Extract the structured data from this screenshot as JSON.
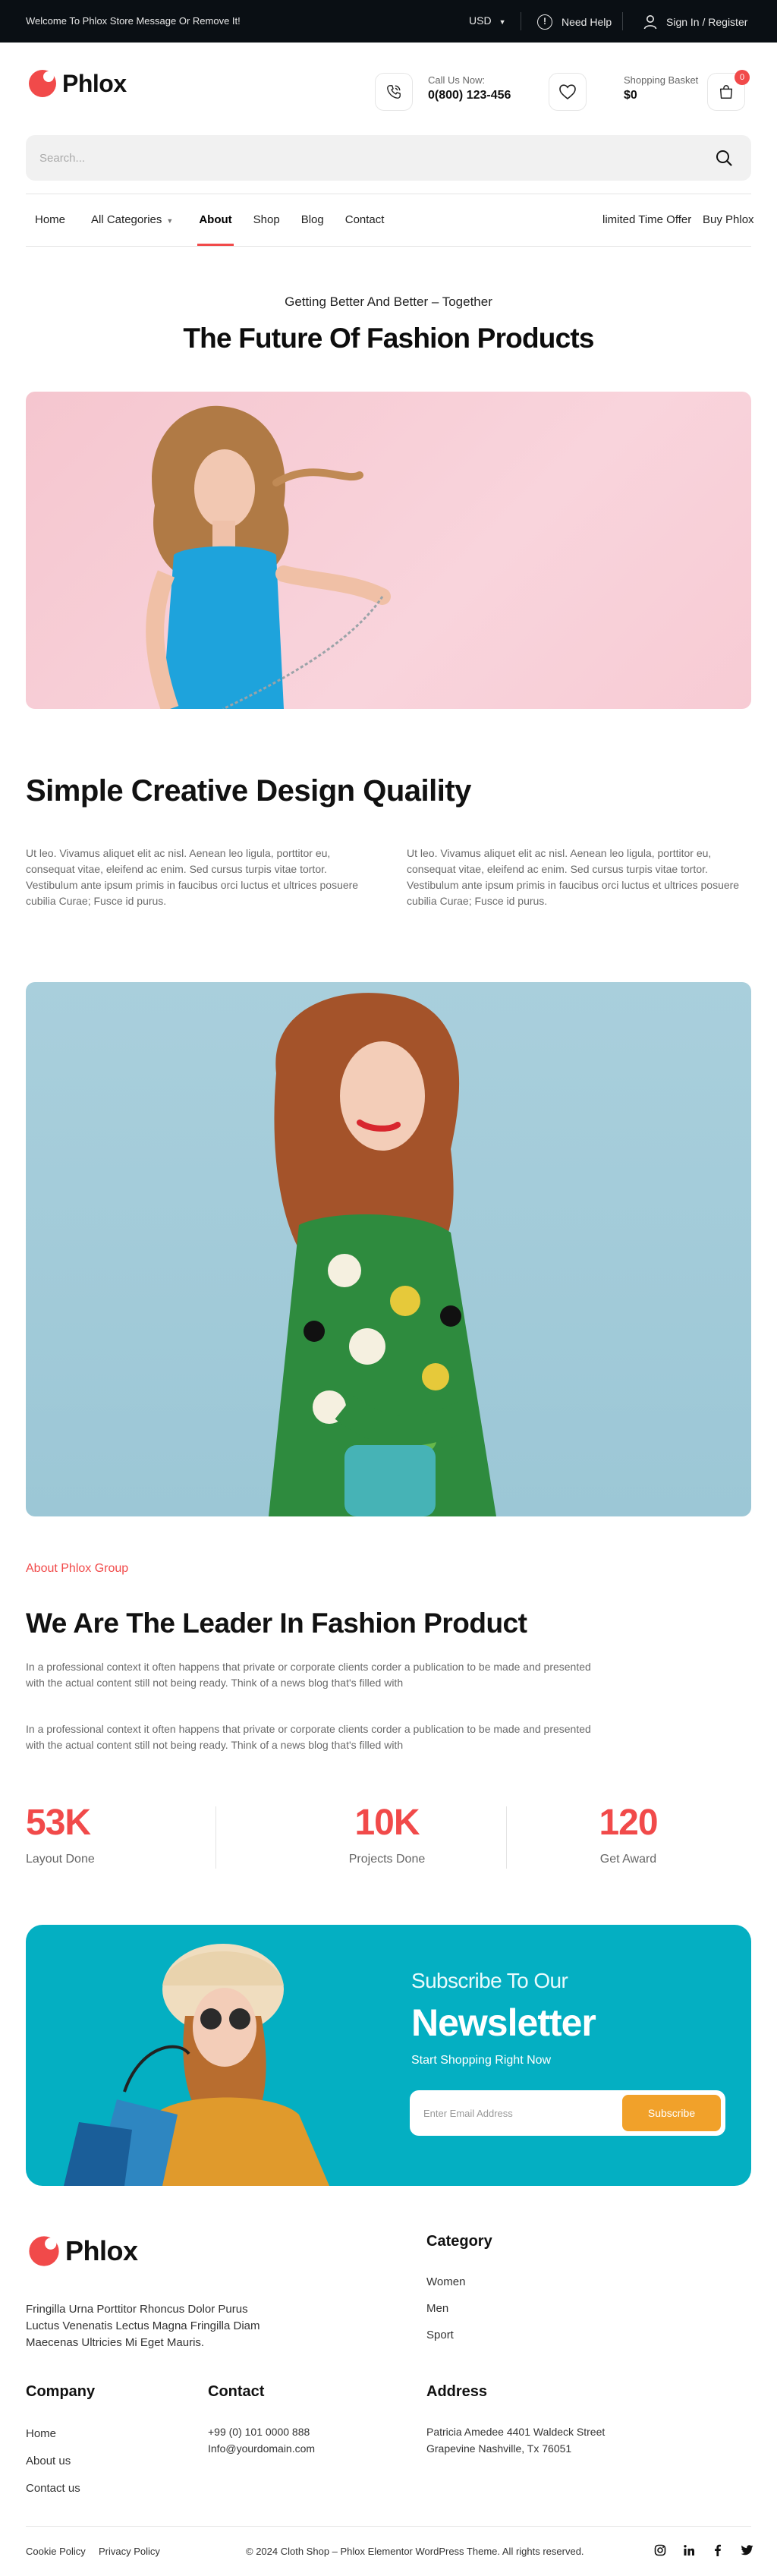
{
  "topbar": {
    "message": "Welcome To Phlox Store Message Or Remove It!",
    "currency": "USD",
    "help": "Need Help",
    "signin": "Sign In / Register"
  },
  "header": {
    "logo": "Phlox",
    "call_label": "Call Us Now:",
    "phone": "0(800) 123-456",
    "basket_label": "Shopping Basket",
    "basket_total": "$0",
    "cart_count": "0"
  },
  "search": {
    "placeholder": "Search..."
  },
  "nav": {
    "items": [
      "Home",
      "All Categories",
      "About",
      "Shop",
      "Blog",
      "Contact"
    ],
    "right": [
      "limited Time Offer",
      "Buy Phlox"
    ]
  },
  "hero": {
    "kicker": "Getting Better And Better – Together",
    "title": "The Future Of Fashion Products"
  },
  "creative": {
    "title": "Simple Creative Design Quaility",
    "text_left": "Ut leo. Vivamus aliquet elit ac nisl. Aenean leo ligula, porttitor eu, consequat vitae, eleifend ac enim. Sed cursus turpis vitae tortor. Vestibulum ante ipsum primis in faucibus orci luctus et ultrices posuere cubilia Curae; Fusce id purus.",
    "text_right": "Ut leo. Vivamus aliquet elit ac nisl. Aenean leo ligula, porttitor eu, consequat vitae, eleifend ac enim. Sed cursus turpis vitae tortor. Vestibulum ante ipsum primis in faucibus orci luctus et ultrices posuere cubilia Curae; Fusce id purus."
  },
  "about": {
    "kicker": "About Phlox Group",
    "title": "We Are The Leader In Fashion Product",
    "p1": "In a professional context it often happens that private or corporate clients corder a publication to be made and presented with the actual content still not being ready. Think of a news blog that's filled with",
    "p2": "In a professional context it often happens that private or corporate clients corder a publication to be made and presented with the actual content still not being ready. Think of a news blog that's filled with"
  },
  "stats": [
    {
      "value": "53K",
      "label": "Layout Done"
    },
    {
      "value": "10K",
      "label": "Projects Done"
    },
    {
      "value": "120",
      "label": "Get Award"
    }
  ],
  "newsletter": {
    "kicker": "Subscribe To Our",
    "title": "Newsletter",
    "subtitle": "Start Shopping Right Now",
    "placeholder": "Enter Email Address",
    "button": "Subscribe"
  },
  "footer": {
    "logo": "Phlox",
    "description": "Fringilla Urna Porttitor Rhoncus Dolor Purus Luctus Venenatis Lectus Magna Fringilla Diam Maecenas Ultricies Mi Eget Mauris.",
    "category_title": "Category",
    "categories": [
      "Women",
      "Men",
      "Sport"
    ],
    "company_title": "Company",
    "company_links": [
      "Home",
      "About us",
      "Contact us"
    ],
    "contact_title": "Contact",
    "phone": "+99 (0) 101 0000 888",
    "email": "Info@yourdomain.com",
    "address_title": "Address",
    "address_line1": "Patricia Amedee 4401 Waldeck Street",
    "address_line2": "Grapevine Nashville, Tx 76051",
    "cookie": "Cookie Policy",
    "privacy": "Privacy Policy",
    "copyright": "© 2024 Cloth Shop – Phlox Elementor WordPress Theme. All rights reserved."
  },
  "colors": {
    "accent": "#f14a4a",
    "newsletter_bg": "#04afc2",
    "subscribe_button": "#f1a12a",
    "topbar_bg": "#0a0f14"
  },
  "icons": [
    "info-icon",
    "user-icon",
    "phone-icon",
    "heart-icon",
    "bag-icon",
    "search-icon",
    "instagram-icon",
    "linkedin-icon",
    "facebook-icon",
    "twitter-icon"
  ]
}
